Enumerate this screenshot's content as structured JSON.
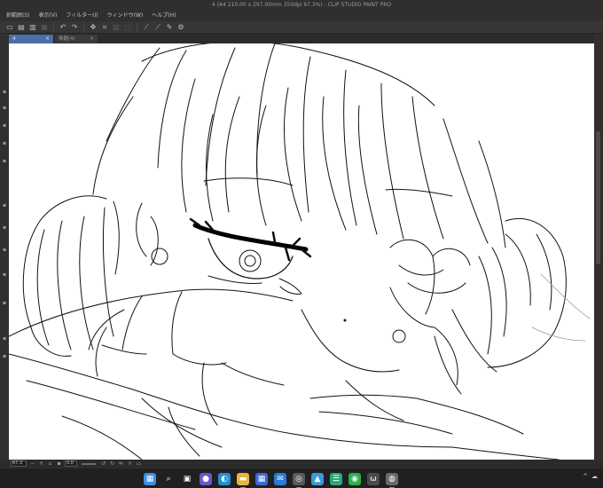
{
  "window": {
    "title": "4 (A4 210.00 x 297.00mm 350dpi 67.3%)  - CLIP STUDIO PAINT PRO"
  },
  "menu": {
    "items": [
      "択範囲(S)",
      "表示(V)",
      "フィルター(I)",
      "ウィンドウ(W)",
      "ヘルプ(H)"
    ]
  },
  "toolbar": {
    "buttons": [
      {
        "name": "new-icon",
        "glyph": "▭"
      },
      {
        "name": "open-icon",
        "glyph": "▤"
      },
      {
        "name": "save-icon",
        "glyph": "▥"
      },
      {
        "name": "print-icon",
        "glyph": "▦"
      },
      {
        "name": "undo-icon",
        "glyph": "↶"
      },
      {
        "name": "redo-icon",
        "glyph": "↷"
      },
      {
        "name": "transform-icon",
        "glyph": "✥"
      },
      {
        "name": "crop-icon",
        "glyph": "⌗"
      },
      {
        "name": "fill-icon",
        "glyph": "▨"
      },
      {
        "name": "clear-icon",
        "glyph": "▢"
      },
      {
        "name": "ruler-icon",
        "glyph": "⟋"
      },
      {
        "name": "snap-icon",
        "glyph": "⟋"
      },
      {
        "name": "pen-icon",
        "glyph": "✎"
      },
      {
        "name": "settings-icon",
        "glyph": "⚙"
      }
    ]
  },
  "tabs": [
    {
      "label": "4",
      "active": true
    },
    {
      "label": "無題(4)",
      "active": false
    }
  ],
  "status": {
    "zoom": "67.3",
    "rotation": "0.0"
  },
  "taskbar": {
    "apps": [
      {
        "name": "start-icon",
        "glyph": "▦",
        "color": "#3a8ee6",
        "running": false
      },
      {
        "name": "search-icon",
        "glyph": "⌕",
        "color": "#202020",
        "running": false
      },
      {
        "name": "task-view-icon",
        "glyph": "▣",
        "color": "#202020",
        "running": false
      },
      {
        "name": "chat-icon",
        "glyph": "●",
        "color": "#6a56c9",
        "running": false
      },
      {
        "name": "edge-icon",
        "glyph": "◐",
        "color": "#1f8fd8",
        "running": false
      },
      {
        "name": "explorer-icon",
        "glyph": "▬",
        "color": "#e7b53a",
        "running": true
      },
      {
        "name": "store-icon",
        "glyph": "▦",
        "color": "#3a6ad8",
        "running": false
      },
      {
        "name": "mail-icon",
        "glyph": "✉",
        "color": "#2a7ad8",
        "running": false
      },
      {
        "name": "clip-studio-icon",
        "glyph": "◎",
        "color": "#5a5a5a",
        "running": true
      },
      {
        "name": "photos-icon",
        "glyph": "▲",
        "color": "#3a9ad8",
        "running": false
      },
      {
        "name": "notes-icon",
        "glyph": "☰",
        "color": "#2aa878",
        "running": false
      },
      {
        "name": "line-icon",
        "glyph": "◉",
        "color": "#2ab04a",
        "running": false
      },
      {
        "name": "browser-icon",
        "glyph": "ω",
        "color": "#4a4a4a",
        "running": false
      },
      {
        "name": "paint-icon",
        "glyph": "◍",
        "color": "#6a6a6a",
        "running": true
      }
    ],
    "tray": [
      "^",
      "☁"
    ]
  },
  "colors": {
    "accent": "#4a6ea8",
    "canvas": "#ffffff",
    "chrome": "#2b2b2b"
  }
}
